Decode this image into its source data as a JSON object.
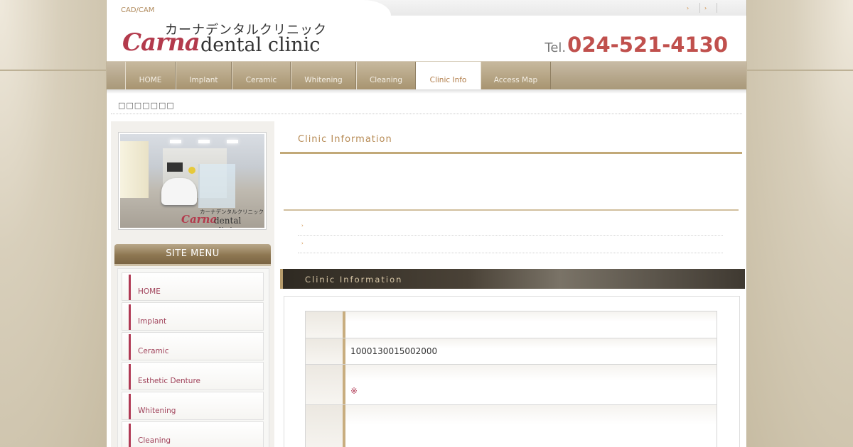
{
  "header": {
    "tagline": "CAD/CAM",
    "top_links": [
      "›",
      "›",
      ""
    ],
    "logo": {
      "jp": "カーナデンタルクリニック",
      "carna": "Carna",
      "dental": "dental clinic"
    },
    "tel_prefix": "Tel.",
    "tel_number": "024-521-4130"
  },
  "nav": {
    "items": [
      {
        "label": "HOME",
        "active": false
      },
      {
        "label": "Implant",
        "active": false
      },
      {
        "label": "Ceramic",
        "active": false
      },
      {
        "label": "Whitening",
        "active": false
      },
      {
        "label": "Cleaning",
        "active": false
      },
      {
        "label": "Clinic Info",
        "active": true
      },
      {
        "label": "Access Map",
        "active": false
      }
    ]
  },
  "breadcrumb": "□□□□□□□",
  "sidebar": {
    "photo_caption": {
      "jp": "カーナデンタルクリニック",
      "carna": "Carna",
      "dental": "dental clinic"
    },
    "menu_title": "SITE MENU",
    "menu_items": [
      "HOME",
      "Implant",
      "Ceramic",
      "Esthetic Denture",
      "Whitening",
      "Cleaning"
    ]
  },
  "main": {
    "heading": "Clinic Information",
    "list_arrows": [
      "›",
      "›"
    ],
    "band_title": "Clinic Information",
    "table": {
      "row1": "",
      "row2": "1000130015002000",
      "row3_note": "※",
      "row4": ""
    }
  },
  "colors": {
    "accent": "#c0504d",
    "brand_pink": "#b03a55",
    "gold": "#c2a978"
  }
}
